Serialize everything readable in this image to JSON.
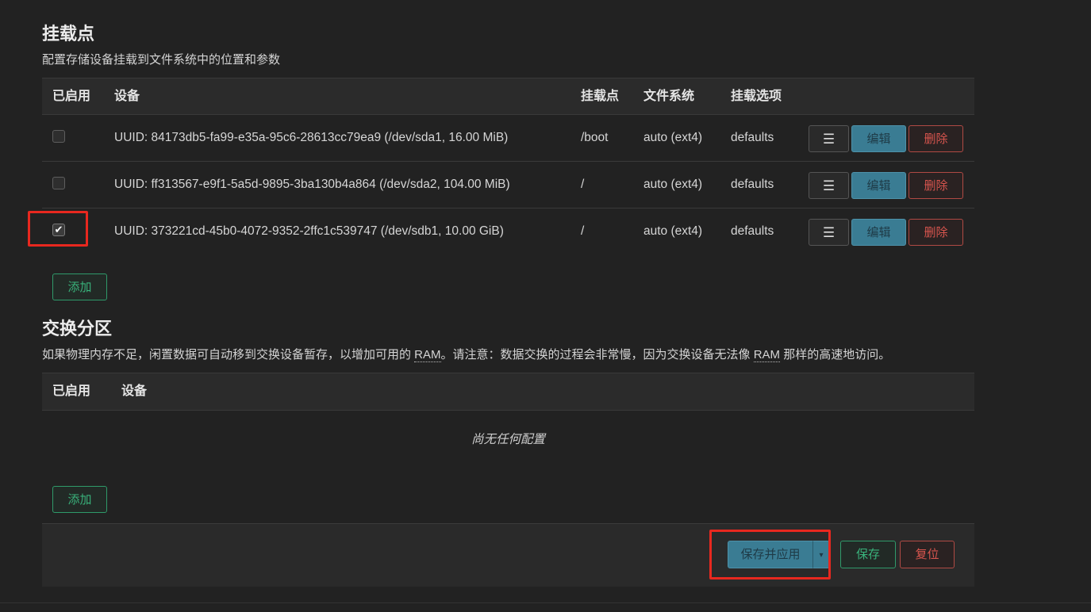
{
  "mount_points": {
    "title": "挂载点",
    "description": "配置存储设备挂载到文件系统中的位置和参数",
    "columns": {
      "enabled": "已启用",
      "device": "设备",
      "mount_point": "挂载点",
      "filesystem": "文件系统",
      "options": "挂载选项"
    },
    "rows": [
      {
        "enabled": false,
        "device": "UUID: 84173db5-fa99-e35a-95c6-28613cc79ea9 (/dev/sda1, 16.00 MiB)",
        "mount_point": "/boot",
        "filesystem": "auto (ext4)",
        "options": "defaults"
      },
      {
        "enabled": false,
        "device": "UUID: ff313567-e9f1-5a5d-9895-3ba130b4a864 (/dev/sda2, 104.00 MiB)",
        "mount_point": "/",
        "filesystem": "auto (ext4)",
        "options": "defaults"
      },
      {
        "enabled": true,
        "device": "UUID: 373221cd-45b0-4072-9352-2ffc1c539747 (/dev/sdb1, 10.00 GiB)",
        "mount_point": "/",
        "filesystem": "auto (ext4)",
        "options": "defaults"
      }
    ],
    "row_buttons": {
      "menu": "☰",
      "edit": "编辑",
      "delete": "删除"
    },
    "add_button": "添加"
  },
  "swap": {
    "title": "交换分区",
    "description_part1": "如果物理内存不足，闲置数据可自动移到交换设备暂存，以增加可用的 ",
    "ram_abbr_1": "RAM",
    "description_part2": "。请注意：数据交换的过程会非常慢，因为交换设备无法像 ",
    "ram_abbr_2": "RAM",
    "description_part3": " 那样的高速地访问。",
    "columns": {
      "enabled": "已启用",
      "device": "设备"
    },
    "empty_text": "尚无任何配置",
    "add_button": "添加"
  },
  "footer": {
    "save_apply": "保存并应用",
    "dropdown_arrow": "▾",
    "save": "保存",
    "reset": "复位"
  },
  "check_mark": "✔",
  "colors": {
    "background": "#222222",
    "primary": "#3a7c93",
    "positive": "#39b27b",
    "negative": "#d8554e",
    "annotation": "#e8281f"
  }
}
